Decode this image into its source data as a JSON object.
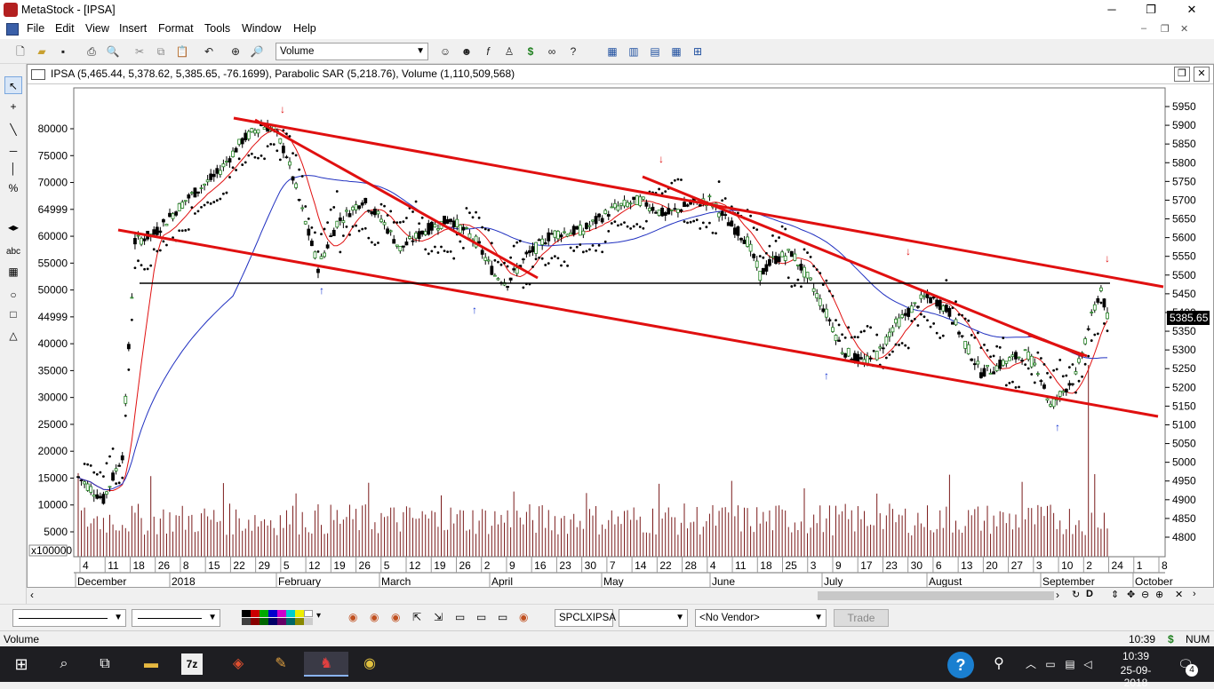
{
  "window": {
    "title": "MetaStock - [IPSA]"
  },
  "menu": [
    "File",
    "Edit",
    "View",
    "Insert",
    "Format",
    "Tools",
    "Window",
    "Help"
  ],
  "toolbar": {
    "indicator_select": "Volume"
  },
  "chart_header": {
    "text": "IPSA (5,465.44, 5,378.62, 5,385.65, -76.1699), Parabolic SAR (5,218.76), Volume (1,110,509,568)"
  },
  "chart_data": {
    "type": "candlestick",
    "symbol": "IPSA",
    "price_axis": {
      "labels": [
        "5950",
        "5900",
        "5850",
        "5800",
        "5750",
        "5700",
        "5650",
        "5600",
        "5550",
        "5500",
        "5450",
        "5400",
        "5350",
        "5300",
        "5250",
        "5200",
        "5150",
        "5100",
        "5050",
        "5000",
        "4950",
        "4900",
        "4850",
        "4800"
      ],
      "range": [
        4770,
        5980
      ]
    },
    "last_price": "5385.65",
    "volume_axis": {
      "labels": [
        "80000",
        "75000",
        "70000",
        "64999",
        "60000",
        "55000",
        "50000",
        "44999",
        "40000",
        "35000",
        "30000",
        "25000",
        "20000",
        "15000",
        "10000",
        "5000"
      ],
      "multiplier": "x100000"
    },
    "date_ticks": [
      "4",
      "11",
      "18",
      "26",
      "8",
      "15",
      "22",
      "29",
      "5",
      "12",
      "19",
      "26",
      "5",
      "12",
      "19",
      "26",
      "2",
      "9",
      "16",
      "23",
      "30",
      "7",
      "14",
      "22",
      "28",
      "4",
      "11",
      "18",
      "25",
      "3",
      "9",
      "17",
      "23",
      "30",
      "6",
      "13",
      "20",
      "27",
      "3",
      "10",
      "2",
      "24",
      "1",
      "8"
    ],
    "months": [
      "December",
      "2018",
      "February",
      "March",
      "April",
      "May",
      "June",
      "July",
      "August",
      "September",
      "October"
    ],
    "series": [
      {
        "name": "Parabolic SAR",
        "value": "5,218.76"
      },
      {
        "name": "Volume",
        "value": "1,110,509,568"
      }
    ],
    "last_bar": {
      "open": "5,465.44",
      "low": "5,378.62",
      "close": "5,385.65",
      "change": "-76.1699"
    }
  },
  "bottom_toolbar": {
    "security": "SPCLXIPSA",
    "vendor": "<No Vendor>",
    "trade": "Trade"
  },
  "statusbar": {
    "left": "Volume",
    "time": "10:39",
    "currency": "$",
    "num": "NUM"
  },
  "taskbar": {
    "time": "10:39",
    "date": "25-09-2018",
    "notifications": "4"
  }
}
